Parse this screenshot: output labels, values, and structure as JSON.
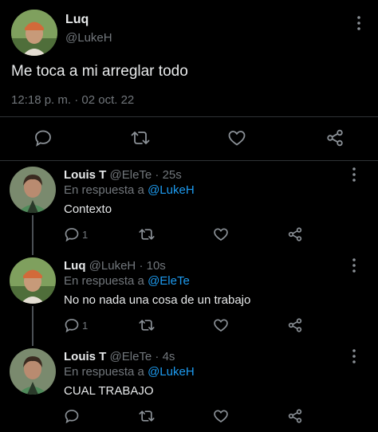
{
  "main_tweet": {
    "display_name": "Luq",
    "handle": "@LukeH",
    "text": "Me toca a mi arreglar todo",
    "timestamp": "12:18 p. m. · 02 oct. 22"
  },
  "replies": [
    {
      "display_name": "Louis T",
      "handle": "@EleTe",
      "time": "· 25s",
      "reply_prefix": "En respuesta a",
      "reply_to": "@LukeH",
      "text": "Contexto",
      "reply_count": "1"
    },
    {
      "display_name": "Luq",
      "handle": "@LukeH",
      "time": "· 10s",
      "reply_prefix": "En respuesta a",
      "reply_to": "@EleTe",
      "text": "No no nada una cosa de un trabajo",
      "reply_count": "1"
    },
    {
      "display_name": "Louis T",
      "handle": "@EleTe",
      "time": "· 4s",
      "reply_prefix": "En respuesta a",
      "reply_to": "@LukeH",
      "text": "CUAL TRABAJO",
      "reply_count": ""
    }
  ],
  "colors": {
    "background": "#000000",
    "text": "#e7e9ea",
    "muted": "#71767b",
    "accent": "#1d9bf0"
  },
  "icons": [
    "kebab-menu-icon",
    "reply-icon",
    "retweet-icon",
    "like-icon",
    "share-icon"
  ]
}
